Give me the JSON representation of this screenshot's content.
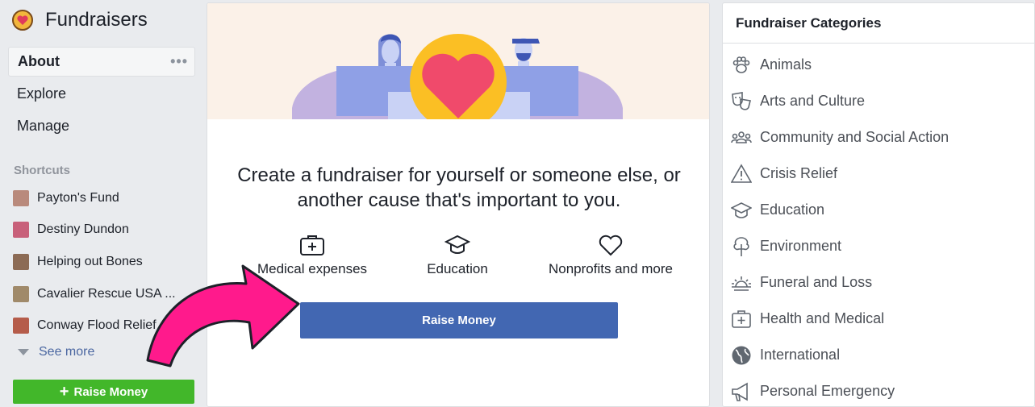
{
  "app": {
    "title": "Fundraisers"
  },
  "nav": {
    "items": [
      {
        "label": "About"
      },
      {
        "label": "Explore"
      },
      {
        "label": "Manage"
      }
    ],
    "more": "•••"
  },
  "shortcuts": {
    "heading": "Shortcuts",
    "items": [
      {
        "label": "Payton's Fund",
        "color": "#b98a7c"
      },
      {
        "label": "Destiny Dundon",
        "color": "#c8607a"
      },
      {
        "label": "Helping out Bones",
        "color": "#8c6b55"
      },
      {
        "label": "Cavalier Rescue USA ...",
        "color": "#a08a6a"
      },
      {
        "label": "Conway Flood Relief ...",
        "color": "#b55c4a"
      }
    ],
    "see_more": "See more"
  },
  "left_button": {
    "label": "Raise Money",
    "icon": "+"
  },
  "main": {
    "headline_line1": "Create a fundraiser for yourself or someone else, or",
    "headline_line2": "another cause that's important to you.",
    "options": [
      {
        "label": "Medical expenses",
        "icon": "medical-kit-icon"
      },
      {
        "label": "Education",
        "icon": "graduation-cap-icon"
      },
      {
        "label": "Nonprofits and more",
        "icon": "heart-icon"
      }
    ],
    "raise_button": "Raise Money"
  },
  "categories": {
    "heading": "Fundraiser Categories",
    "items": [
      {
        "label": "Animals",
        "icon": "paw-icon"
      },
      {
        "label": "Arts and Culture",
        "icon": "theater-masks-icon"
      },
      {
        "label": "Community and Social Action",
        "icon": "people-group-icon"
      },
      {
        "label": "Crisis Relief",
        "icon": "warning-triangle-icon"
      },
      {
        "label": "Education",
        "icon": "graduation-cap-icon"
      },
      {
        "label": "Environment",
        "icon": "tree-icon"
      },
      {
        "label": "Funeral and Loss",
        "icon": "sunset-icon"
      },
      {
        "label": "Health and Medical",
        "icon": "medical-kit-icon"
      },
      {
        "label": "International",
        "icon": "globe-icon"
      },
      {
        "label": "Personal Emergency",
        "icon": "megaphone-icon"
      }
    ]
  },
  "colors": {
    "brand_blue": "#4267b2",
    "green": "#42b72a",
    "arrow_pink": "#ff1a8c",
    "link": "#4b67a1"
  }
}
